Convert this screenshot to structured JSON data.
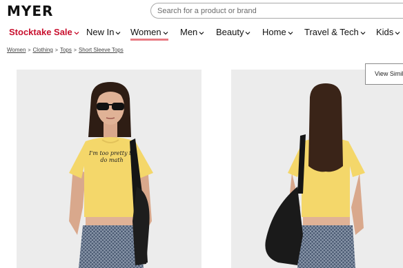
{
  "brand": {
    "logo_text": "MYER"
  },
  "search": {
    "placeholder": "Search for a product or brand"
  },
  "nav": {
    "items": [
      {
        "label": "Stocktake Sale"
      },
      {
        "label": "New In"
      },
      {
        "label": "Women"
      },
      {
        "label": "Men"
      },
      {
        "label": "Beauty"
      },
      {
        "label": "Home"
      },
      {
        "label": "Travel & Tech"
      },
      {
        "label": "Kids"
      }
    ],
    "active": "Women"
  },
  "breadcrumb": {
    "items": [
      {
        "label": "Women"
      },
      {
        "label": "Clothing"
      },
      {
        "label": "Tops"
      },
      {
        "label": "Short Sleeve Tops"
      }
    ],
    "separator": ">"
  },
  "product": {
    "tshirt_slogan": "I'm too pretty to do math",
    "view_similar_label": "View Simil"
  },
  "colors": {
    "sale_red": "#c8102e",
    "active_underline": "#e87a82",
    "tshirt_yellow": "#f4d76a",
    "photo_bg": "#ececec"
  },
  "icons": [
    "chevron-down-icon"
  ]
}
